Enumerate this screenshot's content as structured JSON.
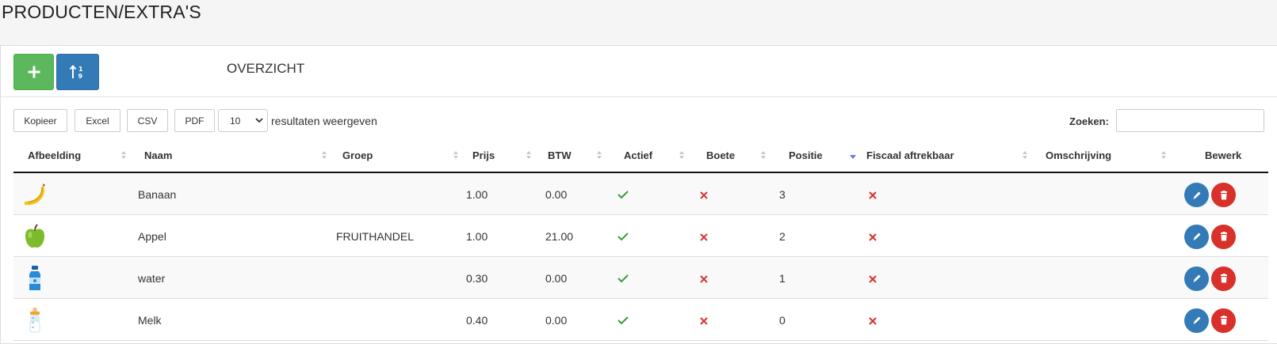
{
  "page": {
    "title": "PRODUCTEN/EXTRA'S"
  },
  "panel": {
    "title": "OVERZICHT",
    "add_icon": "plus-icon",
    "sort_icon": "sort-order-icon"
  },
  "toolbar": {
    "buttons": [
      "Kopieer",
      "Excel",
      "CSV",
      "PDF"
    ],
    "page_length": "10",
    "page_length_label": "resultaten weergeven",
    "search_label": "Zoeken:",
    "search_value": ""
  },
  "table": {
    "columns": [
      "Afbeelding",
      "Naam",
      "Groep",
      "Prijs",
      "BTW",
      "Actief",
      "Boete",
      "Positie",
      "Fiscaal aftrekbaar",
      "Omschrijving",
      "Bewerk"
    ],
    "sorted_column": "Positie",
    "sorted_direction": "desc",
    "rows": [
      {
        "image": "banana-icon",
        "naam": "Banaan",
        "groep": "",
        "prijs": "1.00",
        "btw": "0.00",
        "actief": true,
        "boete": false,
        "positie": "3",
        "fiscaal": false,
        "omschrijving": ""
      },
      {
        "image": "apple-icon",
        "naam": "Appel",
        "groep": "FRUITHANDEL",
        "prijs": "1.00",
        "btw": "21.00",
        "actief": true,
        "boete": false,
        "positie": "2",
        "fiscaal": false,
        "omschrijving": ""
      },
      {
        "image": "water-bottle-icon",
        "naam": "water",
        "groep": "",
        "prijs": "0.30",
        "btw": "0.00",
        "actief": true,
        "boete": false,
        "positie": "1",
        "fiscaal": false,
        "omschrijving": ""
      },
      {
        "image": "baby-bottle-icon",
        "naam": "Melk",
        "groep": "",
        "prijs": "0.40",
        "btw": "0.00",
        "actief": true,
        "boete": false,
        "positie": "0",
        "fiscaal": false,
        "omschrijving": ""
      }
    ]
  },
  "colors": {
    "add_button": "#5cb85c",
    "sort_button": "#337ab7",
    "edit_button": "#337ab7",
    "delete_button": "#d9302b",
    "check": "#3c9a3c",
    "cross": "#d9302b"
  }
}
